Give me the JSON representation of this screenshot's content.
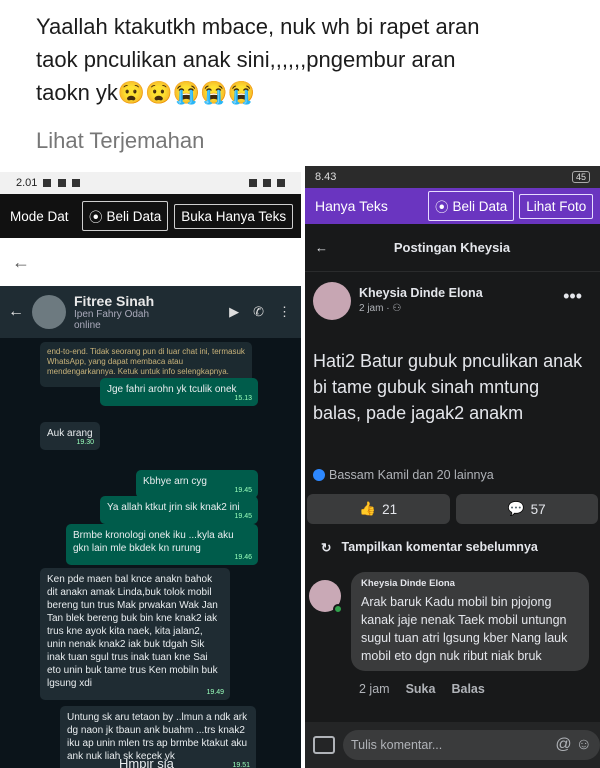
{
  "post": {
    "text_line1": "Yaallah ktakutkh mbace, nuk wh bi rapet aran",
    "text_line2": "taok  pnculikan anak sini,,,,,,pngembur aran",
    "text_line3": "taokn yk😧😧😭😭😭",
    "translate_label": "Lihat Terjemahan"
  },
  "left": {
    "status_time": "2.01",
    "toolbar": {
      "mode_label": "Mode Dat",
      "beli_data": "Beli Data",
      "buka_teks": "Buka Hanya Teks"
    },
    "back": "←",
    "chat": {
      "contact_name": "Fitree Sinah",
      "contact_sub": "Ipen Fahry Odah",
      "contact_status": "online",
      "system_note": "end-to-end. Tidak seorang pun di luar chat ini, termasuk WhatsApp, yang dapat membaca atau mendengarkannya. Ketuk untuk info selengkapnya.",
      "messages": [
        {
          "text": "Jge  fahri arohn yk tculik onek",
          "time": "15.13"
        },
        {
          "text": "Auk arang",
          "time": "19.30"
        },
        {
          "text": "Kbhye arn cyg",
          "time": "19.45"
        },
        {
          "text": "Ya allah ktkut jrin sik knak2 ini",
          "time": "19.45"
        },
        {
          "text": "Brmbe kronologi onek iku ...kyla aku gkn lain mle bkdek kn rurung",
          "time": "19.46"
        },
        {
          "text": "Ken pde maen bal knce anakn bahok dit anakn amak Linda,buk tolok mobil bereng tun trus Mak prwakan Wak Jan Tan blek bereng buk bin kne knak2 iak trus kne ayok kita naek, kita jalan2, unin nenak knak2 iak buk tdgah Sik inak tuan sgul trus inak tuan kne Sai eto unin buk tame trus Ken mobiln buk lgsung xdi",
          "time": "19.49"
        },
        {
          "text": "Untung sk aru tetaon by ..lmun a ndk ark dg naon jk tbaun ank buahm ...trs knak2 iku ap unin mlen trs ap brmbe ktakut aku ank nuk liah sk kecek yk",
          "time": "19.51"
        },
        {
          "text": "Hmpir sja",
          "time": ""
        }
      ]
    }
  },
  "right": {
    "status_time": "8.43",
    "battery": "45",
    "toolbar": {
      "mode_label": "Hanya Teks",
      "beli_data": "Beli Data",
      "lihat_foto": "Lihat Foto"
    },
    "header_title": "Postingan Kheysia",
    "author": "Kheysia Dinde Elona",
    "time_meta": "2 jam · ⚇",
    "post_text": "Hati2 Batur gubuk pnculikan anak bi tame gubuk sinah mntung balas, pade jagak2 anakm",
    "reactions_text": "Bassam Kamil dan 20 lainnya",
    "likes_count": "21",
    "comments_count": "57",
    "prev_comments": "Tampilkan komentar sebelumnya",
    "comment": {
      "author": "Kheysia Dinde Elona",
      "text": "Arak baruk Kadu mobil bin pjojong kanak jaje nenak Taek mobil untungn sugul tuan atri lgsung kber Nang lauk mobil eto dgn nuk ribut niak bruk",
      "time": "2 jam",
      "like": "Suka",
      "reply": "Balas"
    },
    "comment_placeholder": "Tulis komentar..."
  }
}
